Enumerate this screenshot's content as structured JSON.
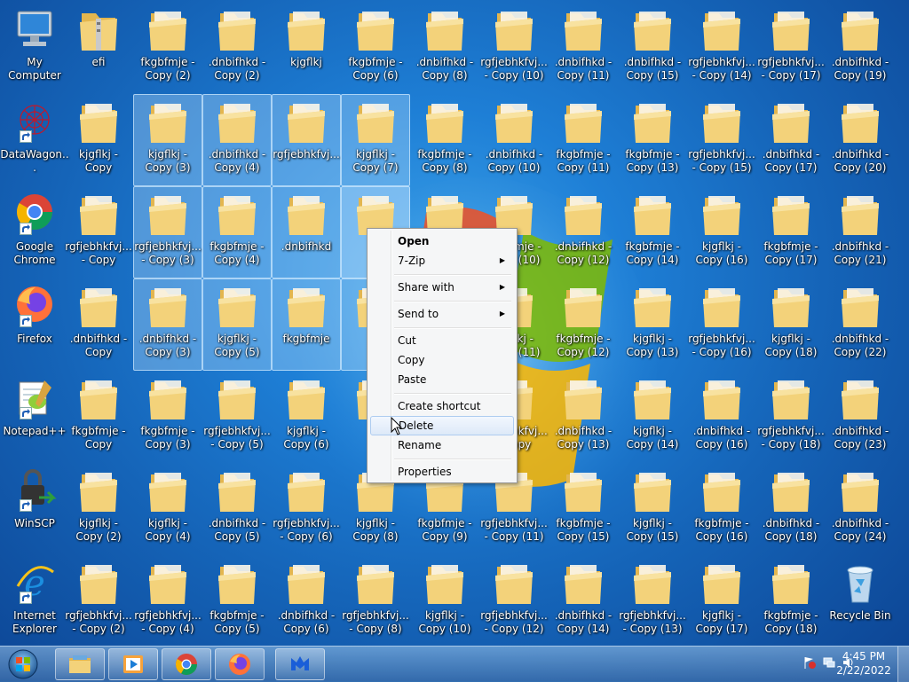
{
  "desktop": {
    "columns": [
      [
        {
          "label": "My Computer",
          "type": "computer"
        },
        {
          "label": "DataWagon...",
          "type": "datawagon",
          "shortcut": true
        },
        {
          "label": "Google Chrome",
          "type": "chrome",
          "shortcut": true
        },
        {
          "label": "Firefox",
          "type": "firefox",
          "shortcut": true
        },
        {
          "label": "Notepad++",
          "type": "notepad",
          "shortcut": true
        },
        {
          "label": "WinSCP",
          "type": "winscp",
          "shortcut": true
        },
        {
          "label": "Internet Explorer",
          "type": "ie",
          "shortcut": true
        }
      ],
      [
        {
          "label": "efi",
          "type": "zipfolder"
        },
        {
          "label": "kjgflkj - Copy",
          "type": "folder"
        },
        {
          "label": "rgfjebhkfvj... - Copy",
          "type": "folder"
        },
        {
          "label": ".dnbifhkd - Copy",
          "type": "folder"
        },
        {
          "label": "fkgbfmje - Copy",
          "type": "folder"
        },
        {
          "label": "kjgflkj - Copy (2)",
          "type": "folder"
        },
        {
          "label": "rgfjebhkfvj... - Copy (2)",
          "type": "folder"
        }
      ],
      [
        {
          "label": "fkgbfmje - Copy (2)",
          "type": "folder"
        },
        {
          "label": "kjgflkj - Copy (3)",
          "type": "folder",
          "selected": true
        },
        {
          "label": "rgfjebhkfvj... - Copy (3)",
          "type": "folder",
          "selected": true
        },
        {
          "label": ".dnbifhkd - Copy (3)",
          "type": "folder",
          "selected": true
        },
        {
          "label": "fkgbfmje - Copy (3)",
          "type": "folder"
        },
        {
          "label": "kjgflkj - Copy (4)",
          "type": "folder"
        },
        {
          "label": "rgfjebhkfvj... - Copy (4)",
          "type": "folder"
        }
      ],
      [
        {
          "label": ".dnbifhkd - Copy (2)",
          "type": "folder"
        },
        {
          "label": ".dnbifhkd - Copy (4)",
          "type": "folder",
          "selected": true
        },
        {
          "label": "fkgbfmje - Copy (4)",
          "type": "folder",
          "selected": true
        },
        {
          "label": "kjgflkj - Copy (5)",
          "type": "folder",
          "selected": true
        },
        {
          "label": "rgfjebhkfvj... - Copy (5)",
          "type": "folder"
        },
        {
          "label": ".dnbifhkd - Copy (5)",
          "type": "folder"
        },
        {
          "label": "fkgbfmje - Copy (5)",
          "type": "folder"
        }
      ],
      [
        {
          "label": "kjgflkj",
          "type": "folder"
        },
        {
          "label": "rgfjebhkfvj...",
          "type": "folder",
          "selected": true
        },
        {
          "label": ".dnbifhkd",
          "type": "folder",
          "selected": true
        },
        {
          "label": "fkgbfmje",
          "type": "folder",
          "selected": true
        },
        {
          "label": "kjgflkj - Copy (6)",
          "type": "folder"
        },
        {
          "label": "rgfjebhkfvj... - Copy (6)",
          "type": "folder"
        },
        {
          "label": ".dnbifhkd - Copy (6)",
          "type": "folder"
        }
      ],
      [
        {
          "label": "fkgbfmje - Copy (6)",
          "type": "folder"
        },
        {
          "label": "kjgflkj - Copy (7)",
          "type": "folder",
          "selected": true
        },
        {
          "label": "",
          "type": "folder",
          "selected": true,
          "focused": true
        },
        {
          "label": "",
          "type": "folder",
          "selected": true
        },
        {
          "label": "",
          "type": "folder"
        },
        {
          "label": "kjgflkj - Copy (8)",
          "type": "folder"
        },
        {
          "label": "rgfjebhkfvj... - Copy (8)",
          "type": "folder"
        }
      ],
      [
        {
          "label": ".dnbifhkd - Copy (8)",
          "type": "folder"
        },
        {
          "label": "fkgbfmje - Copy (8)",
          "type": "folder"
        },
        {
          "label": "",
          "type": "folder"
        },
        {
          "label": "",
          "type": "folder"
        },
        {
          "label": "",
          "type": "folder"
        },
        {
          "label": "fkgbfmje - Copy (9)",
          "type": "folder"
        },
        {
          "label": "kjgflkj - Copy (10)",
          "type": "folder"
        }
      ],
      [
        {
          "label": "rgfjebhkfvj... - Copy (10)",
          "type": "folder"
        },
        {
          "label": ".dnbifhkd - Copy (10)",
          "type": "folder"
        },
        {
          "label": "fkgbfmje - Copy (10)",
          "type": "folder"
        },
        {
          "label": "kjgflkj - Copy (11)",
          "type": "folder"
        },
        {
          "label": "rgfjebhkfvj... - Copy",
          "type": "folder"
        },
        {
          "label": "rgfjebhkfvj... - Copy (11)",
          "type": "folder"
        },
        {
          "label": "rgfjebhkfvj... - Copy (12)",
          "type": "folder"
        }
      ],
      [
        {
          "label": ".dnbifhkd - Copy (11)",
          "type": "folder"
        },
        {
          "label": "fkgbfmje - Copy (11)",
          "type": "folder"
        },
        {
          "label": ".dnbifhkd - Copy (12)",
          "type": "folder"
        },
        {
          "label": "fkgbfmje - Copy (12)",
          "type": "folder"
        },
        {
          "label": ".dnbifhkd - Copy (13)",
          "type": "folder"
        },
        {
          "label": "fkgbfmje - Copy (15)",
          "type": "folder"
        },
        {
          "label": ".dnbifhkd - Copy (14)",
          "type": "folder"
        }
      ],
      [
        {
          "label": ".dnbifhkd - Copy (15)",
          "type": "folder"
        },
        {
          "label": "fkgbfmje - Copy (13)",
          "type": "folder"
        },
        {
          "label": "fkgbfmje - Copy (14)",
          "type": "folder"
        },
        {
          "label": "kjgflkj - Copy (13)",
          "type": "folder"
        },
        {
          "label": "kjgflkj - Copy (14)",
          "type": "folder"
        },
        {
          "label": "kjgflkj - Copy (15)",
          "type": "folder"
        },
        {
          "label": "rgfjebhkfvj... - Copy (13)",
          "type": "folder"
        }
      ],
      [
        {
          "label": "rgfjebhkfvj... - Copy (14)",
          "type": "folder"
        },
        {
          "label": "rgfjebhkfvj... - Copy (15)",
          "type": "folder"
        },
        {
          "label": "kjgflkj - Copy (16)",
          "type": "folder"
        },
        {
          "label": "rgfjebhkfvj... - Copy (16)",
          "type": "folder"
        },
        {
          "label": ".dnbifhkd - Copy (16)",
          "type": "folder"
        },
        {
          "label": "fkgbfmje - Copy (16)",
          "type": "folder"
        },
        {
          "label": "kjgflkj - Copy (17)",
          "type": "folder"
        }
      ],
      [
        {
          "label": "rgfjebhkfvj... - Copy (17)",
          "type": "folder"
        },
        {
          "label": ".dnbifhkd - Copy (17)",
          "type": "folder"
        },
        {
          "label": "fkgbfmje - Copy (17)",
          "type": "folder"
        },
        {
          "label": "kjgflkj - Copy (18)",
          "type": "folder"
        },
        {
          "label": "rgfjebhkfvj... - Copy (18)",
          "type": "folder"
        },
        {
          "label": ".dnbifhkd - Copy (18)",
          "type": "folder"
        },
        {
          "label": "fkgbfmje - Copy (18)",
          "type": "folder"
        }
      ],
      [
        {
          "label": ".dnbifhkd - Copy (19)",
          "type": "folder"
        },
        {
          "label": ".dnbifhkd - Copy (20)",
          "type": "folder"
        },
        {
          "label": ".dnbifhkd - Copy (21)",
          "type": "folder"
        },
        {
          "label": ".dnbifhkd - Copy (22)",
          "type": "folder"
        },
        {
          "label": ".dnbifhkd - Copy (23)",
          "type": "folder"
        },
        {
          "label": ".dnbifhkd - Copy (24)",
          "type": "folder"
        },
        {
          "label": "Recycle Bin",
          "type": "recycle"
        }
      ]
    ]
  },
  "context_menu": {
    "open": "Open",
    "seven_zip": "7-Zip",
    "share_with": "Share with",
    "send_to": "Send to",
    "cut": "Cut",
    "copy": "Copy",
    "paste": "Paste",
    "create_shortcut": "Create shortcut",
    "delete": "Delete",
    "rename": "Rename",
    "properties": "Properties",
    "submenu_arrow": "▶"
  },
  "taskbar": {
    "clock_time": "4:45 PM",
    "clock_date": "2/22/2022",
    "pinned": [
      "explorer-icon",
      "media-player-icon",
      "chrome-icon",
      "firefox-icon",
      "malwarebytes-icon"
    ]
  },
  "colors": {
    "folder_front": "#f3d27a",
    "folder_back": "#e3b64f",
    "selection": "#bee1ff"
  }
}
